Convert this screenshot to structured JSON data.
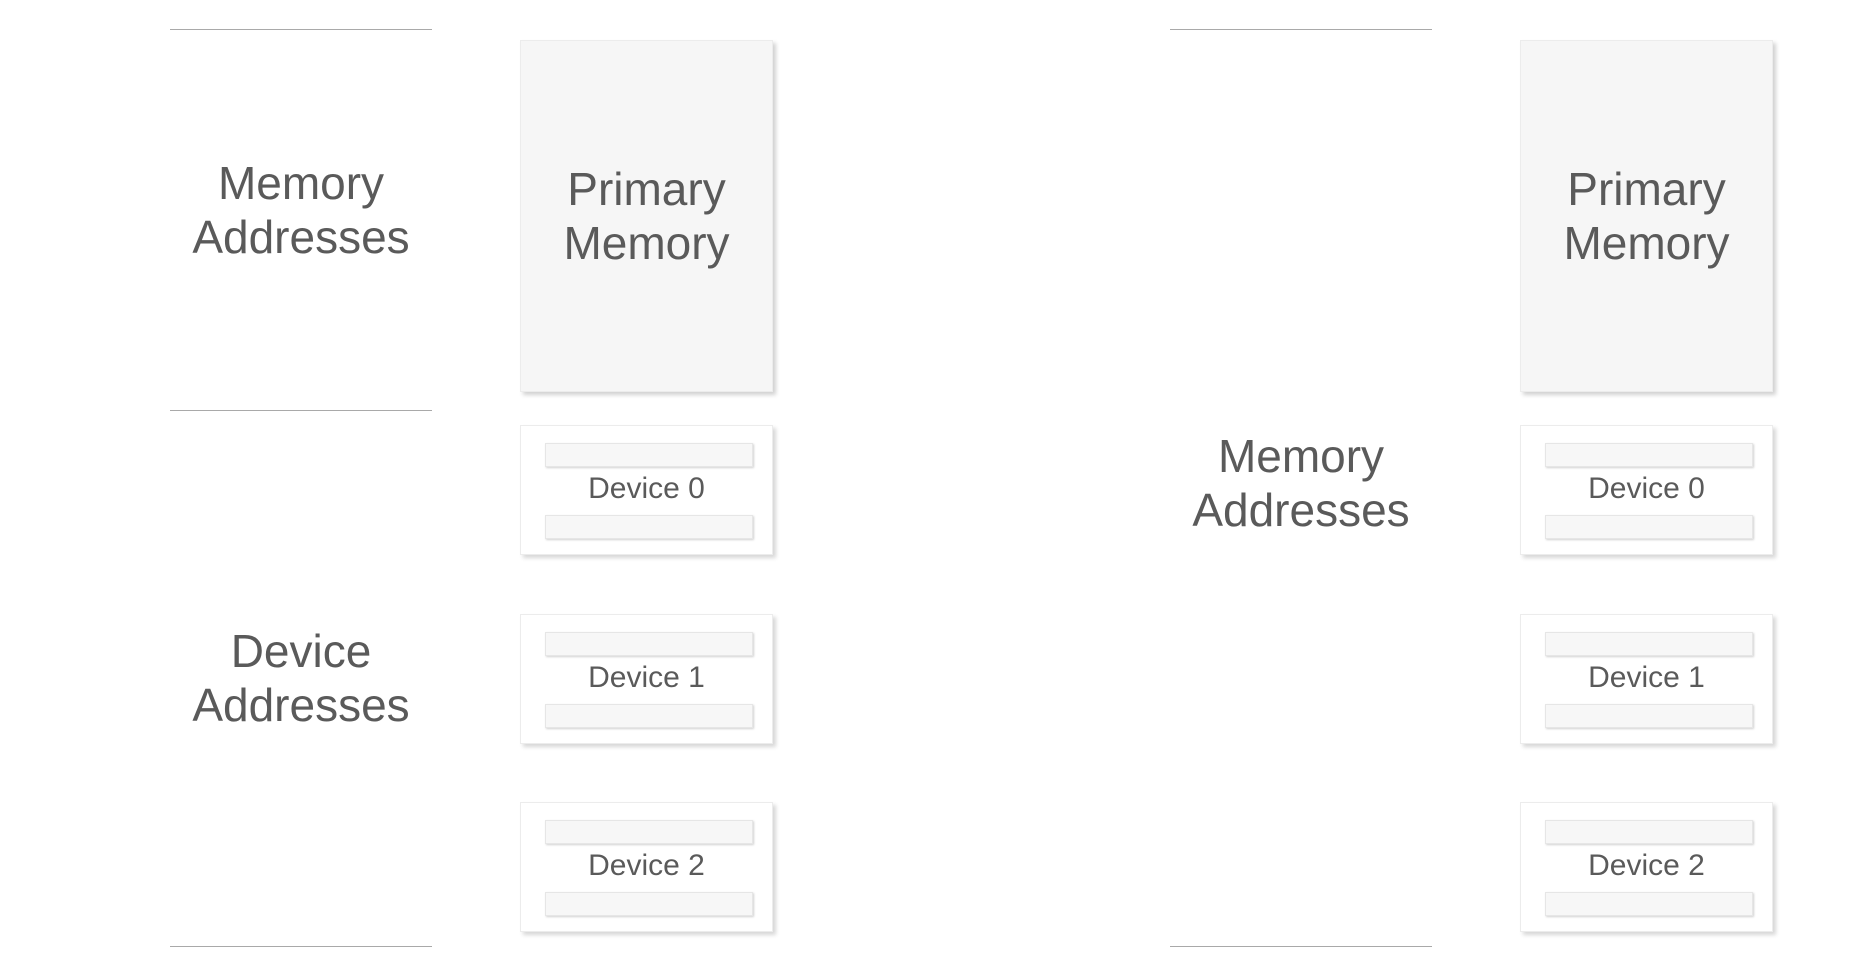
{
  "left_panel": {
    "memory_range_label": "Memory Addresses",
    "device_range_label": "Device Addresses",
    "primary_memory_label": "Primary Memory",
    "devices": [
      {
        "label": "Device 0"
      },
      {
        "label": "Device 1"
      },
      {
        "label": "Device 2"
      }
    ]
  },
  "right_panel": {
    "memory_range_label": "Memory Addresses",
    "primary_memory_label": "Primary Memory",
    "devices": [
      {
        "label": "Device 0"
      },
      {
        "label": "Device 1"
      },
      {
        "label": "Device 2"
      }
    ]
  }
}
